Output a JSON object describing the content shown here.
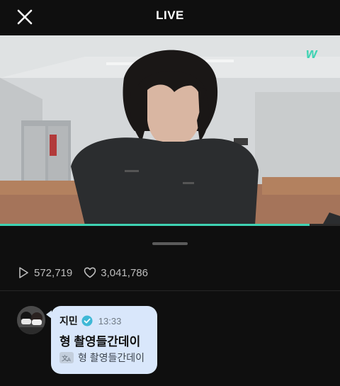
{
  "header": {
    "title": "LIVE",
    "close_icon": "close-icon"
  },
  "player": {
    "watermark_icon": "weverse-logo-icon",
    "accent_color": "#3fd3b3",
    "progress": 0.91
  },
  "stats": {
    "plays": "572,719",
    "likes": "3,041,786",
    "play_icon": "play-icon",
    "like_icon": "heart-icon"
  },
  "comment": {
    "sender": "지민",
    "verified_icon": "verified-badge-icon",
    "time": "13:33",
    "text": "형 촬영들간데이",
    "translation": "형 촬영들간데이",
    "translate_icon": "translate-icon",
    "bubble_color": "#d9e7fb"
  }
}
